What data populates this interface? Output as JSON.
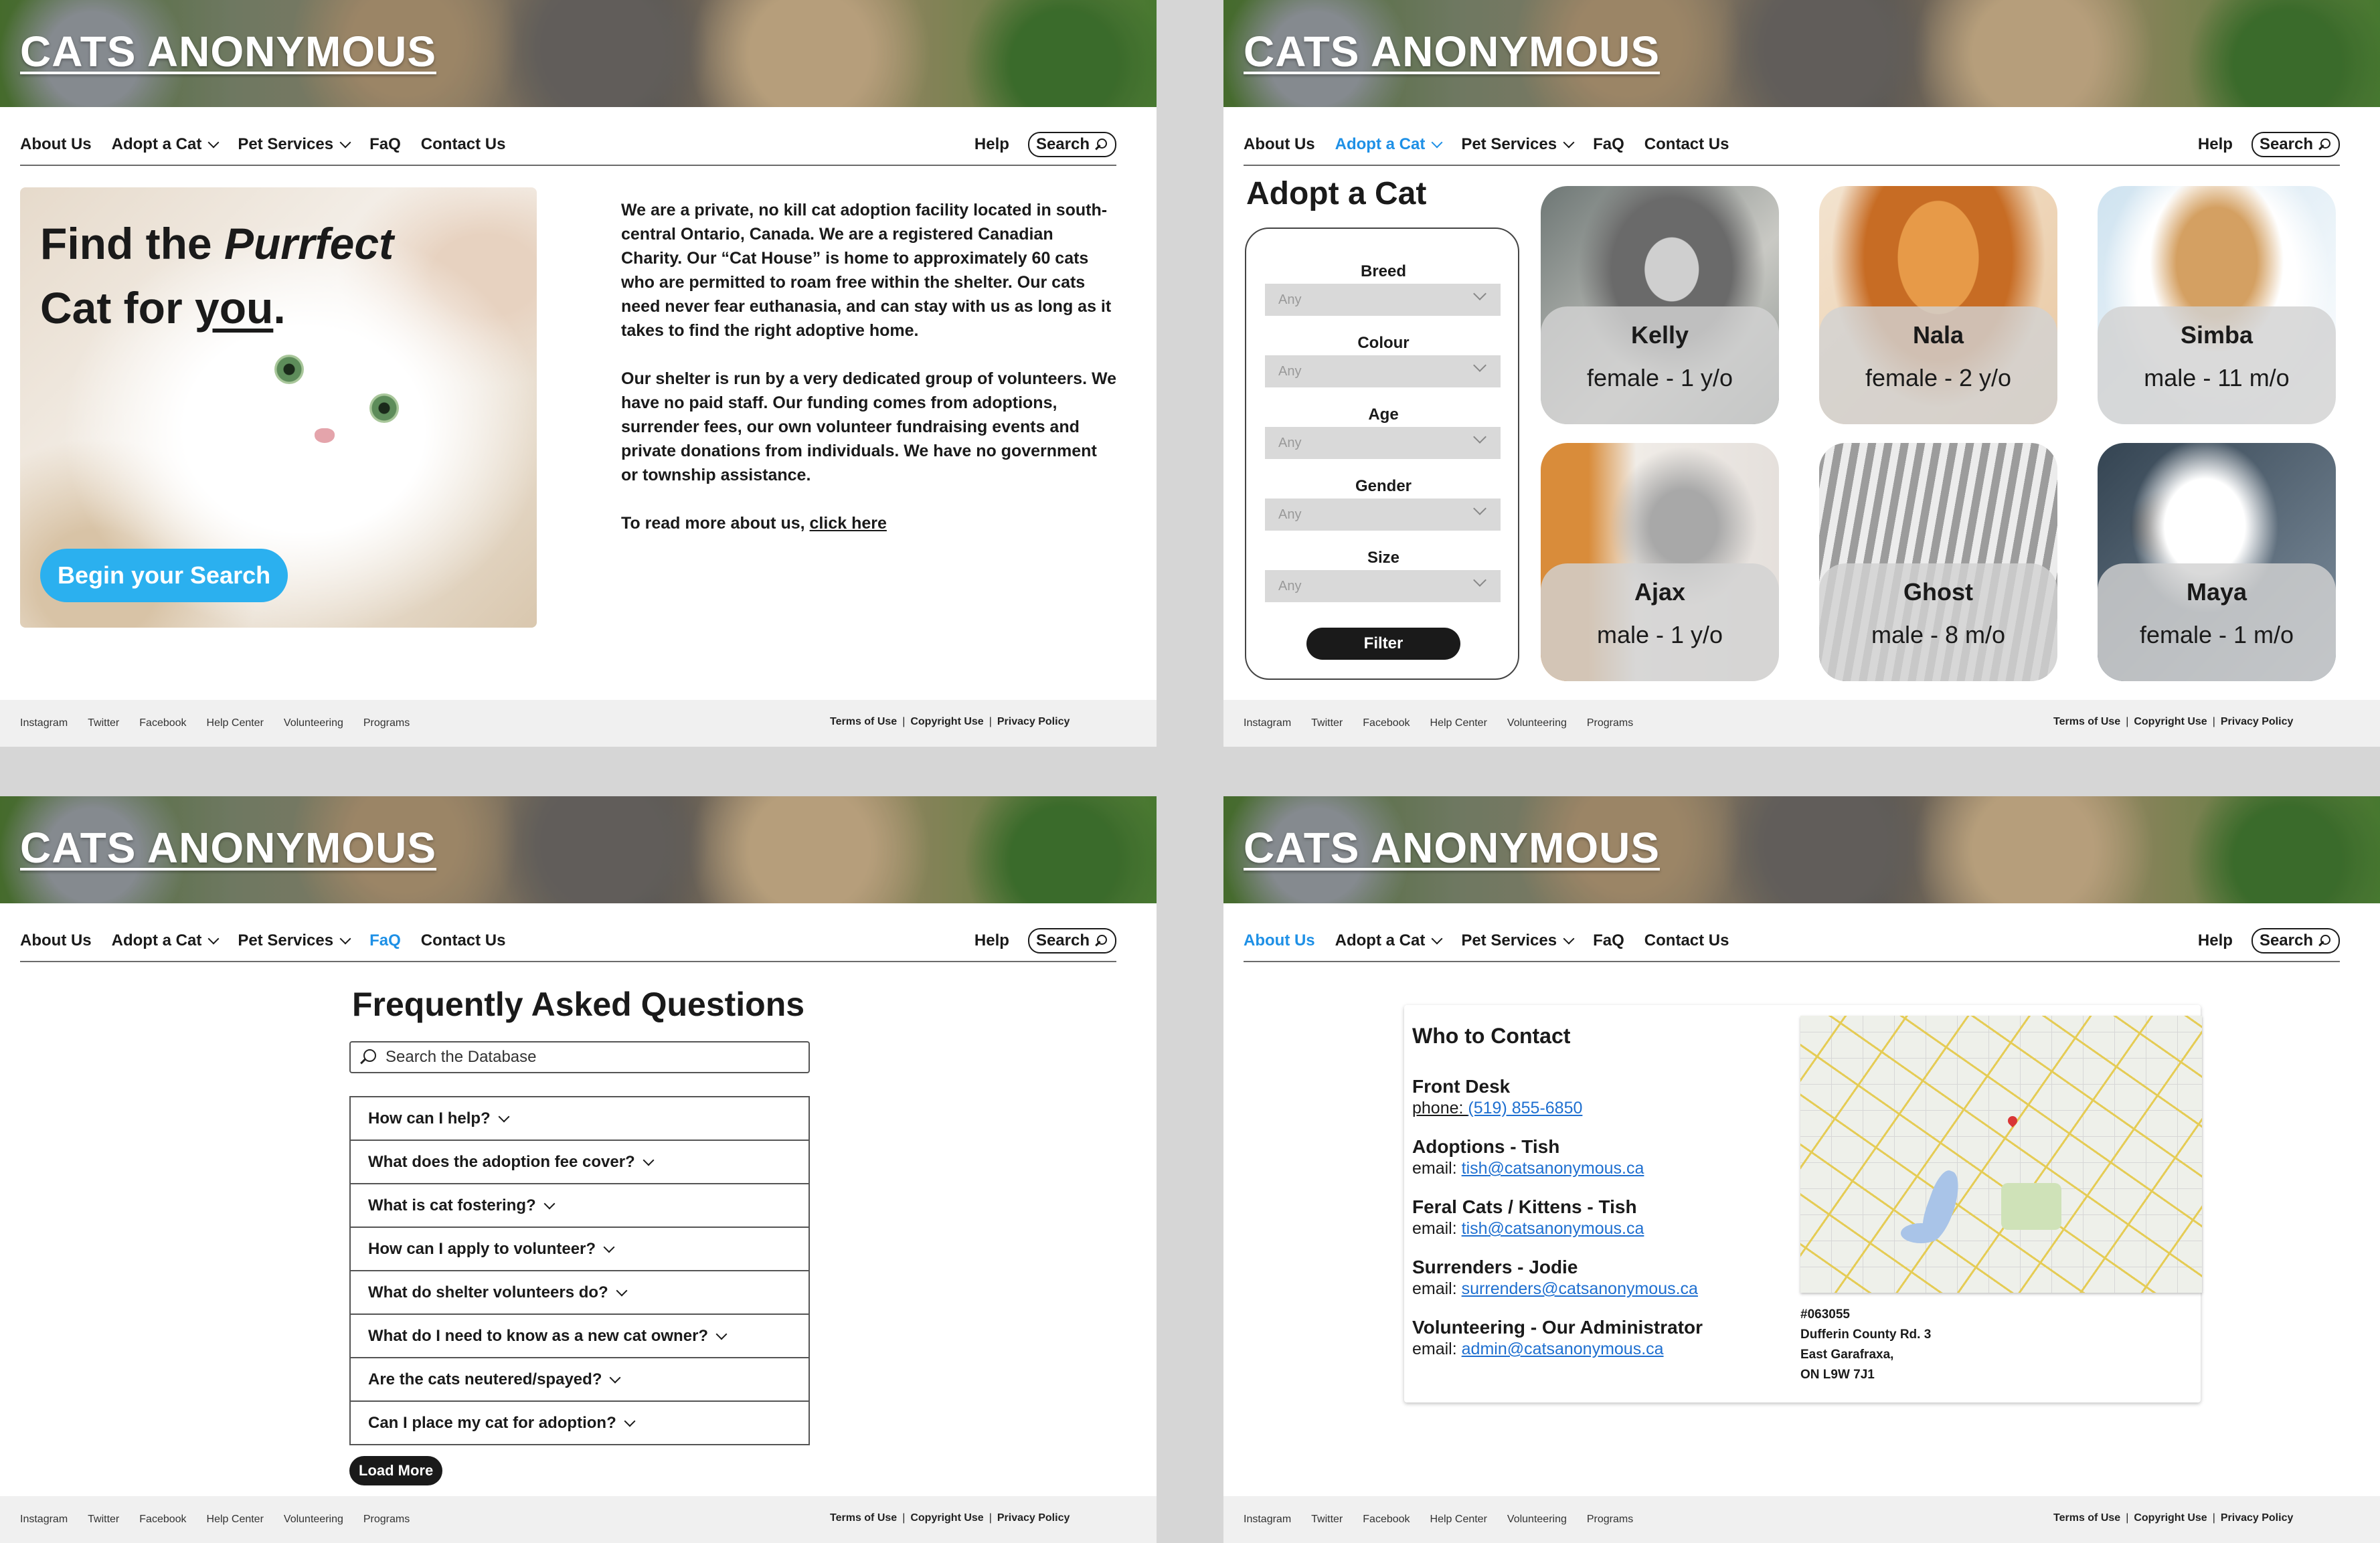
{
  "site": {
    "logo": "CATS ANONYMOUS",
    "nav": {
      "about": "About Us",
      "adopt": "Adopt a Cat",
      "services": "Pet Services",
      "faq": "FaQ",
      "contact": "Contact Us",
      "help": "Help",
      "search": "Search"
    },
    "footer": {
      "links": [
        "Instagram",
        "Twitter",
        "Facebook",
        "Help Center",
        "Volunteering",
        "Programs"
      ],
      "terms": "Terms of Use",
      "copyright": "Copyright Use",
      "privacy": "Privacy Policy"
    },
    "accent_color": "#1e90e6",
    "button_blue": "#2bb0ef"
  },
  "home": {
    "hero_line1_a": "Find the ",
    "hero_line1_b": "Purrfect",
    "hero_line2_a": "Cat for ",
    "hero_line2_b": "you",
    "hero_line2_c": ".",
    "cta": "Begin your Search",
    "para1": "We are a private, no kill cat adoption facility located in south-central Ontario, Canada. We are a registered Canadian Charity. Our “Cat House” is home to approximately 60 cats who are permitted to roam free within the shelter. Our cats need never fear euthanasia, and can stay with us as long as it takes to find the right adoptive home.",
    "para2": "Our shelter is run by a very dedicated group of volunteers. We have no paid staff. Our funding comes from adoptions, surrender fees, our own volunteer fundraising events and private donations from individuals. We have no government or township assistance.",
    "para3_text": "To read more about us, ",
    "para3_link": "click here"
  },
  "adopt": {
    "title": "Adopt a Cat",
    "filters": [
      {
        "label": "Breed",
        "value": "Any"
      },
      {
        "label": "Colour",
        "value": "Any"
      },
      {
        "label": "Age",
        "value": "Any"
      },
      {
        "label": "Gender",
        "value": "Any"
      },
      {
        "label": "Size",
        "value": "Any"
      }
    ],
    "filter_button": "Filter",
    "cats": [
      {
        "name": "Kelly",
        "desc": "female - 1 y/o"
      },
      {
        "name": "Nala",
        "desc": "female - 2 y/o"
      },
      {
        "name": "Simba",
        "desc": "male - 11 m/o"
      },
      {
        "name": "Ajax",
        "desc": "male - 1 y/o"
      },
      {
        "name": "Ghost",
        "desc": "male - 8 m/o"
      },
      {
        "name": "Maya",
        "desc": "female - 1 m/o"
      }
    ]
  },
  "faq": {
    "title": "Frequently Asked Questions",
    "search_placeholder": "Search the Database",
    "questions": [
      "How can I help?",
      "What does the adoption fee cover?",
      "What is cat fostering?",
      "How can I apply to volunteer?",
      "What do shelter volunteers do?",
      "What do I need to know as a new cat owner?",
      "Are the cats neutered/spayed?",
      "Can I place my cat for adoption?"
    ],
    "load_more": "Load More"
  },
  "contact": {
    "title": "Who to Contact",
    "entries": [
      {
        "heading": "Front Desk",
        "prefix": "phone: ",
        "value": "(519) 855-6850"
      },
      {
        "heading": "Adoptions - Tish",
        "prefix": "email: ",
        "value": "tish@catsanonymous.ca"
      },
      {
        "heading": "Feral Cats / Kittens - Tish",
        "prefix": "email: ",
        "value": "tish@catsanonymous.ca"
      },
      {
        "heading": "Surrenders - Jodie",
        "prefix": "email: ",
        "value": "surrenders@catsanonymous.ca"
      },
      {
        "heading": "Volunteering - Our Administrator",
        "prefix": "email: ",
        "value": "admin@catsanonymous.ca"
      }
    ],
    "address": [
      "#063055",
      "Dufferin County Rd. 3",
      "East Garafraxa,",
      "ON L9W 7J1"
    ]
  }
}
